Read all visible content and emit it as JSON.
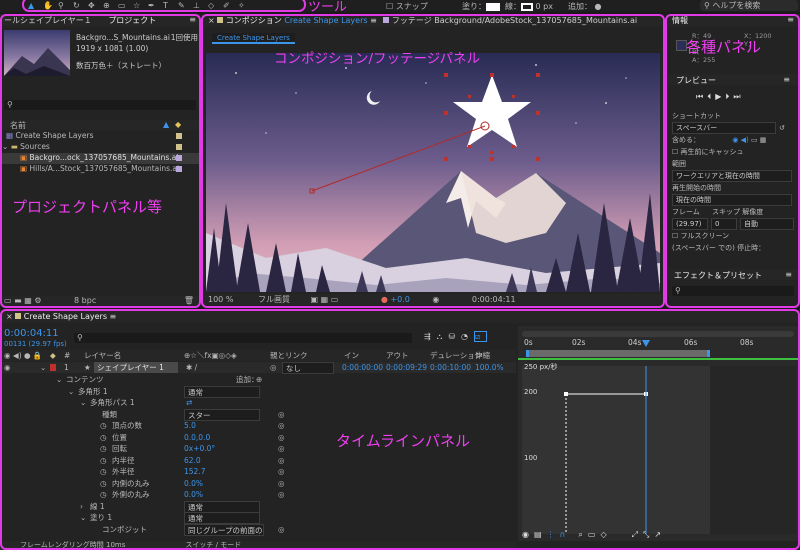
{
  "toolbar": {
    "snap": "スナップ",
    "fill": "塗り：",
    "stroke": "線：",
    "stroke_px": "0 px",
    "add": "追加：",
    "search": "ヘルプを検索"
  },
  "annotations": {
    "tool": "ツール",
    "comp": "コンポジション/フッテージパネル",
    "info": "各種パネル",
    "project": "プロジェクトパネル等",
    "timeline": "タイムラインパネル"
  },
  "project": {
    "tab_prev": "ールシェイプレイヤー１",
    "tab": "プロジェクト",
    "file_name": "Backgro...S_Mountains.ai",
    "usage": "1回使用",
    "size": "1919 x 1081 (1.00)",
    "colors": "数百万色＋（ストレート）",
    "col_name": "名前",
    "items": [
      "Create Shape Layers",
      "Sources",
      "Backgro...ock_137057685_Mountains.ai",
      "Hills/A...Stock_137057685_Mountains.ai"
    ],
    "bpc": "8 bpc"
  },
  "comp": {
    "tab_label": "コンポジション",
    "tab_name": "Create Shape Layers",
    "footage_label": "フッテージ",
    "footage_name": "Background/AdobeStock_137057685_Mountains.ai",
    "sub_tab": "Create Shape Layers",
    "zoom": "100 %",
    "quality": "フル画質",
    "exposure": "+0.0",
    "time": "0:00:04:11"
  },
  "info": {
    "title": "情報",
    "r": "R：",
    "g": "G：",
    "b": "B：",
    "a": "A：255",
    "x": "X：1200",
    "y": "Y：",
    "r_val": "49",
    "g_val": "",
    "preview": "プレビュー",
    "shortcut": "ショートカット",
    "shortcut_val": "スペースバー",
    "include": "含める：",
    "cache": "再生前にキャッシュ",
    "range": "範囲",
    "range_val": "ワークエリアと現在の時間",
    "play_start": "再生開始の時間",
    "play_start_val": "現在の時間",
    "frame": "フレーム",
    "skip": "スキップ",
    "resolution": "解像度",
    "frame_val": "(29.97)",
    "skip_val": "0",
    "res_val": "自動",
    "fullscreen": "フルスクリーン",
    "stop_note": "(スペースバー での) 停止時：",
    "effects": "エフェクト＆プリセット"
  },
  "timeline": {
    "tab": "Create Shape Layers",
    "timecode": "0:00:04:11",
    "fps": "00131 (29.97 fps)",
    "col_layer": "レイヤー名",
    "col_parent": "親とリンク",
    "col_in": "イン",
    "col_out": "アウト",
    "col_dur": "デュレーション",
    "col_stretch": "伸縮",
    "layer_num": "1",
    "layer_name": "シェイプレイヤー 1",
    "parent_val": "なし",
    "in_val": "0:00:00:00",
    "out_val": "0:00:09:29",
    "dur_val": "0:00:10:00",
    "stretch_val": "100.0%",
    "contents": "コンテンツ",
    "add": "追加：",
    "polygon": "多角形 1",
    "normal": "通常",
    "path": "多角形パス 1",
    "type": "種類",
    "type_val": "スター",
    "props": [
      {
        "name": "頂点の数",
        "value": "5.0"
      },
      {
        "name": "位置",
        "value": "0.0,0.0"
      },
      {
        "name": "回転",
        "value": "0x+0.0°"
      },
      {
        "name": "内半径",
        "value": "62.0"
      },
      {
        "name": "外半径",
        "value": "152.7"
      },
      {
        "name": "内側の丸み",
        "value": "0.0%"
      },
      {
        "name": "外側の丸み",
        "value": "0.0%"
      }
    ],
    "stroke": "線 1",
    "fill": "塗り 1",
    "composite": "コンポジット",
    "composite_val": "同じグループの前面の",
    "ruler": [
      "0s",
      "02s",
      "04s",
      "06s",
      "08s"
    ],
    "graph_unit": "250 px/秒",
    "graph_200": "200",
    "graph_100": "100",
    "footer": "フレームレンダリング時間 10ms",
    "switch_label": "スイッチ / モード"
  },
  "colors": {
    "annotation": "#ee3ff0",
    "accent": "#3d95ea"
  }
}
